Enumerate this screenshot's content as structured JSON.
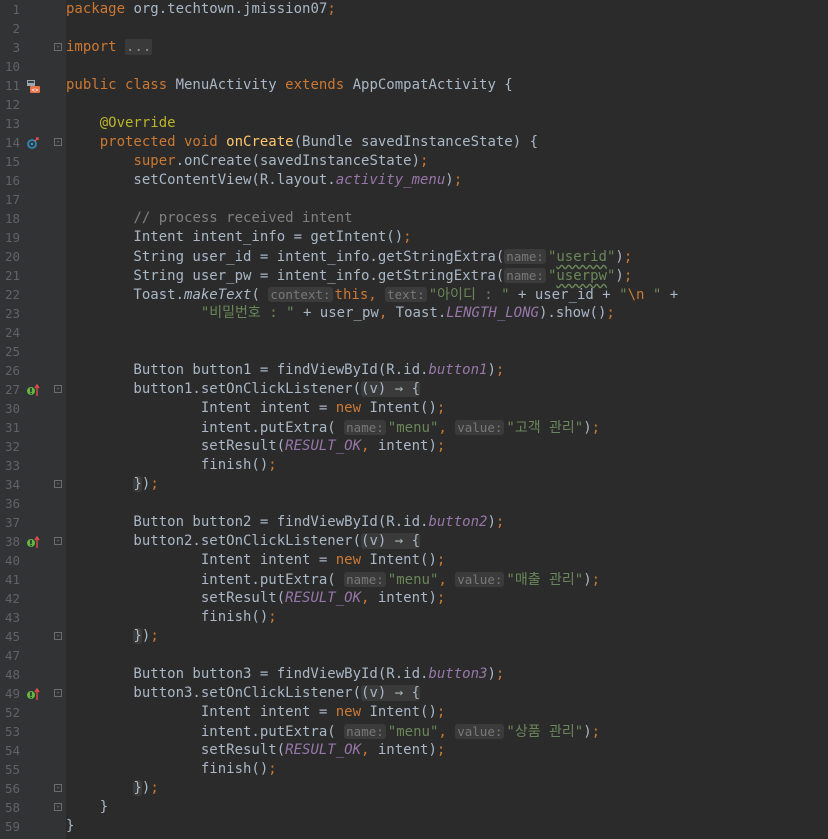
{
  "colors": {
    "background": "#2b2b2b",
    "gutter": "#313335",
    "keyword": "#cc7832",
    "string": "#6a8759",
    "annotation": "#bbb529",
    "method_decl": "#ffc66d",
    "field": "#9876aa",
    "comment": "#808080",
    "text": "#a9b7c6",
    "line_number": "#606366"
  },
  "gutter_markers": {
    "11": "android-activity-icon",
    "14": "override-method-icon",
    "27": "lambda-implements-icon",
    "38": "lambda-implements-icon",
    "49": "lambda-implements-icon"
  },
  "lines": [
    {
      "n": "1",
      "t": [
        [
          "kw",
          "package "
        ],
        [
          "",
          "org.techtown.jmission07"
        ],
        [
          "kw",
          ";"
        ]
      ]
    },
    {
      "n": "2",
      "t": []
    },
    {
      "n": "3",
      "fold": "open",
      "t": [
        [
          "kw",
          "import "
        ],
        [
          "fold-text",
          "..."
        ]
      ]
    },
    {
      "n": "10",
      "t": []
    },
    {
      "n": "11",
      "t": [
        [
          "kw",
          "public class "
        ],
        [
          "",
          "MenuActivity "
        ],
        [
          "kw",
          "extends "
        ],
        [
          "",
          "AppCompatActivity {"
        ]
      ]
    },
    {
      "n": "12",
      "t": []
    },
    {
      "n": "13",
      "t": [
        [
          "",
          "    "
        ],
        [
          "ann",
          "@Override"
        ]
      ]
    },
    {
      "n": "14",
      "fold": "open",
      "t": [
        [
          "",
          "    "
        ],
        [
          "kw",
          "protected void "
        ],
        [
          "fn",
          "onCreate"
        ],
        [
          "",
          "(Bundle savedInstanceState) {"
        ]
      ]
    },
    {
      "n": "15",
      "t": [
        [
          "",
          "        "
        ],
        [
          "kw",
          "super"
        ],
        [
          "",
          ".onCreate(savedInstanceState)"
        ],
        [
          "kw",
          ";"
        ]
      ]
    },
    {
      "n": "16",
      "t": [
        [
          "",
          "        setContentView(R.layout."
        ],
        [
          "fld",
          "activity_menu"
        ],
        [
          "",
          ")"
        ],
        [
          "kw",
          ";"
        ]
      ]
    },
    {
      "n": "17",
      "t": []
    },
    {
      "n": "18",
      "t": [
        [
          "",
          "        "
        ],
        [
          "cmt",
          "// process received intent"
        ]
      ]
    },
    {
      "n": "19",
      "t": [
        [
          "",
          "        Intent intent_info = getIntent()"
        ],
        [
          "kw",
          ";"
        ]
      ]
    },
    {
      "n": "20",
      "t": [
        [
          "",
          "        String user_id = intent_info.getStringExtra("
        ],
        [
          "hint",
          "name:"
        ],
        [
          "str",
          "\""
        ],
        [
          "str wavy",
          "userid"
        ],
        [
          "str",
          "\""
        ],
        [
          "",
          ")"
        ],
        [
          "kw",
          ";"
        ]
      ]
    },
    {
      "n": "21",
      "t": [
        [
          "",
          "        String user_pw = intent_info.getStringExtra("
        ],
        [
          "hint",
          "name:"
        ],
        [
          "str",
          "\""
        ],
        [
          "str wavy",
          "userpw"
        ],
        [
          "str",
          "\""
        ],
        [
          "",
          ")"
        ],
        [
          "kw",
          ";"
        ]
      ]
    },
    {
      "n": "22",
      "t": [
        [
          "",
          "        Toast."
        ],
        [
          "ital",
          "makeText"
        ],
        [
          "",
          "( "
        ],
        [
          "hint",
          "context:"
        ],
        [
          "kw",
          "this, "
        ],
        [
          "hint",
          "text:"
        ],
        [
          "str",
          "\"아이디 : \" "
        ],
        [
          "",
          "+ user_id + "
        ],
        [
          "str",
          "\""
        ],
        [
          "esc",
          "\\n"
        ],
        [
          "str",
          " \" "
        ],
        [
          "",
          "+"
        ]
      ]
    },
    {
      "n": "23",
      "t": [
        [
          "",
          "                "
        ],
        [
          "str",
          "\"비밀번호 : \" "
        ],
        [
          "",
          "+ user_pw"
        ],
        [
          "kw",
          ", "
        ],
        [
          "",
          "Toast."
        ],
        [
          "fld",
          "LENGTH_LONG"
        ],
        [
          "",
          ").show()"
        ],
        [
          "kw",
          ";"
        ]
      ]
    },
    {
      "n": "24",
      "t": []
    },
    {
      "n": "25",
      "t": []
    },
    {
      "n": "26",
      "t": [
        [
          "",
          "        Button button1 = findViewById(R.id."
        ],
        [
          "fld",
          "button1"
        ],
        [
          "",
          ")"
        ],
        [
          "kw",
          ";"
        ]
      ]
    },
    {
      "n": "27",
      "fold": "open",
      "t": [
        [
          "",
          "        button1.setOnClickListener("
        ],
        [
          "lam",
          "(v) → {"
        ]
      ]
    },
    {
      "n": "30",
      "t": [
        [
          "",
          "                Intent intent = "
        ],
        [
          "kw",
          "new "
        ],
        [
          "",
          "Intent()"
        ],
        [
          "kw",
          ";"
        ]
      ]
    },
    {
      "n": "31",
      "t": [
        [
          "",
          "                intent.putExtra( "
        ],
        [
          "hint",
          "name:"
        ],
        [
          "str",
          "\"menu\""
        ],
        [
          "kw",
          ", "
        ],
        [
          "hint",
          "value:"
        ],
        [
          "str",
          "\"고객 관리\""
        ],
        [
          "",
          ")"
        ],
        [
          "kw",
          ";"
        ]
      ]
    },
    {
      "n": "32",
      "t": [
        [
          "",
          "                setResult("
        ],
        [
          "fld",
          "RESULT_OK"
        ],
        [
          "kw",
          ", "
        ],
        [
          "",
          "intent)"
        ],
        [
          "kw",
          ";"
        ]
      ]
    },
    {
      "n": "33",
      "t": [
        [
          "",
          "                finish()"
        ],
        [
          "kw",
          ";"
        ]
      ]
    },
    {
      "n": "34",
      "fold": "close",
      "t": [
        [
          "",
          "        "
        ],
        [
          "lam",
          "}"
        ],
        [
          "",
          ")"
        ],
        [
          "kw",
          ";"
        ]
      ]
    },
    {
      "n": "36",
      "t": []
    },
    {
      "n": "37",
      "t": [
        [
          "",
          "        Button button2 = findViewById(R.id."
        ],
        [
          "fld",
          "button2"
        ],
        [
          "",
          ")"
        ],
        [
          "kw",
          ";"
        ]
      ]
    },
    {
      "n": "38",
      "fold": "open",
      "t": [
        [
          "",
          "        button2.setOnClickListener("
        ],
        [
          "lam",
          "(v) → {"
        ]
      ]
    },
    {
      "n": "40",
      "t": [
        [
          "",
          "                Intent intent = "
        ],
        [
          "kw",
          "new "
        ],
        [
          "",
          "Intent()"
        ],
        [
          "kw",
          ";"
        ]
      ]
    },
    {
      "n": "41",
      "t": [
        [
          "",
          "                intent.putExtra( "
        ],
        [
          "hint",
          "name:"
        ],
        [
          "str",
          "\"menu\""
        ],
        [
          "kw",
          ", "
        ],
        [
          "hint",
          "value:"
        ],
        [
          "str",
          "\"매출 관리\""
        ],
        [
          "",
          ")"
        ],
        [
          "kw",
          ";"
        ]
      ]
    },
    {
      "n": "42",
      "t": [
        [
          "",
          "                setResult("
        ],
        [
          "fld",
          "RESULT_OK"
        ],
        [
          "kw",
          ", "
        ],
        [
          "",
          "intent)"
        ],
        [
          "kw",
          ";"
        ]
      ]
    },
    {
      "n": "43",
      "t": [
        [
          "",
          "                finish()"
        ],
        [
          "kw",
          ";"
        ]
      ]
    },
    {
      "n": "45",
      "fold": "close",
      "t": [
        [
          "",
          "        "
        ],
        [
          "lam",
          "}"
        ],
        [
          "",
          ")"
        ],
        [
          "kw",
          ";"
        ]
      ]
    },
    {
      "n": "47",
      "t": []
    },
    {
      "n": "48",
      "t": [
        [
          "",
          "        Button button3 = findViewById(R.id."
        ],
        [
          "fld",
          "button3"
        ],
        [
          "",
          ")"
        ],
        [
          "kw",
          ";"
        ]
      ]
    },
    {
      "n": "49",
      "fold": "open",
      "t": [
        [
          "",
          "        button3.setOnClickListener("
        ],
        [
          "lam",
          "(v) → {"
        ]
      ]
    },
    {
      "n": "52",
      "t": [
        [
          "",
          "                Intent intent = "
        ],
        [
          "kw",
          "new "
        ],
        [
          "",
          "Intent()"
        ],
        [
          "kw",
          ";"
        ]
      ]
    },
    {
      "n": "53",
      "t": [
        [
          "",
          "                intent.putExtra( "
        ],
        [
          "hint",
          "name:"
        ],
        [
          "str",
          "\"menu\""
        ],
        [
          "kw",
          ", "
        ],
        [
          "hint",
          "value:"
        ],
        [
          "str",
          "\"상품 관리\""
        ],
        [
          "",
          ")"
        ],
        [
          "kw",
          ";"
        ]
      ]
    },
    {
      "n": "54",
      "t": [
        [
          "",
          "                setResult("
        ],
        [
          "fld",
          "RESULT_OK"
        ],
        [
          "kw",
          ", "
        ],
        [
          "",
          "intent)"
        ],
        [
          "kw",
          ";"
        ]
      ]
    },
    {
      "n": "55",
      "t": [
        [
          "",
          "                finish()"
        ],
        [
          "kw",
          ";"
        ]
      ]
    },
    {
      "n": "56",
      "fold": "close",
      "t": [
        [
          "",
          "        "
        ],
        [
          "lam",
          "}"
        ],
        [
          "",
          ")"
        ],
        [
          "kw",
          ";"
        ]
      ]
    },
    {
      "n": "58",
      "fold": "close",
      "t": [
        [
          "",
          "    }"
        ]
      ]
    },
    {
      "n": "59",
      "t": [
        [
          "",
          "}"
        ]
      ]
    }
  ]
}
